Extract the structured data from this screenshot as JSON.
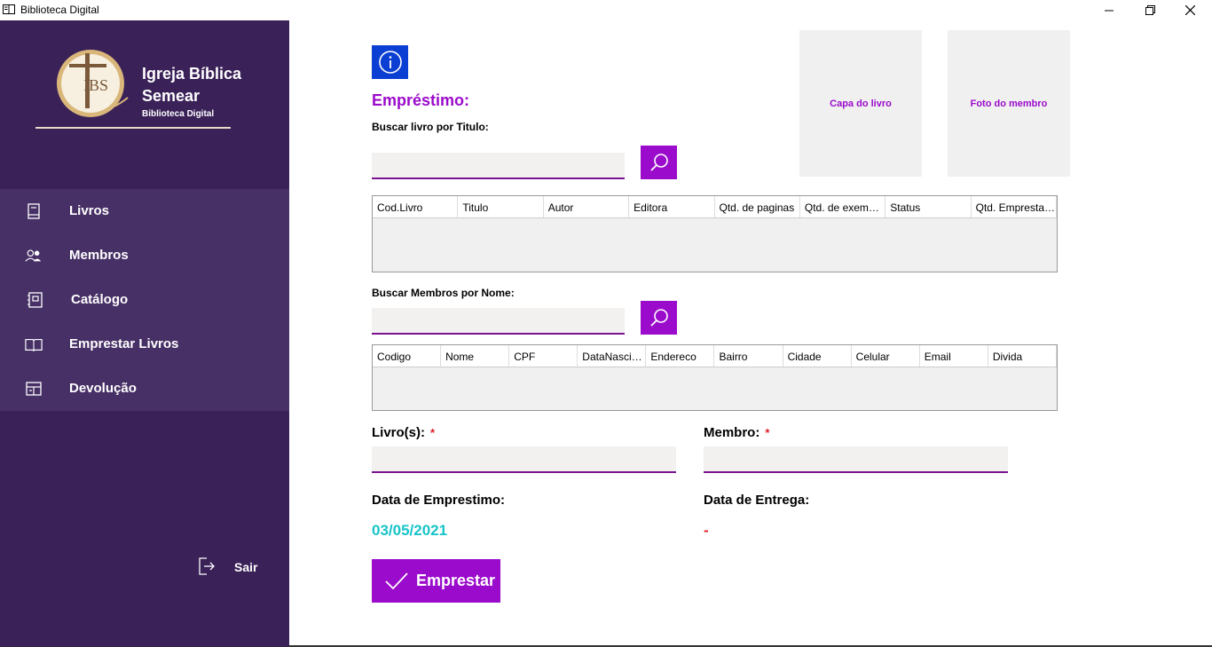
{
  "window": {
    "title": "Biblioteca Digital"
  },
  "sidebar": {
    "logo_text": "IBS",
    "church_name_line1": "Igreja Bíblica",
    "church_name_line2": "Semear",
    "subtitle": "Biblioteca Digital",
    "items": [
      {
        "label": "Livros",
        "icon": "book-icon"
      },
      {
        "label": "Membros",
        "icon": "members-icon"
      },
      {
        "label": "Catálogo",
        "icon": "catalog-icon"
      },
      {
        "label": "Emprestar Livros",
        "icon": "open-book-icon"
      },
      {
        "label": "Devolução",
        "icon": "return-icon"
      }
    ],
    "exit_label": "Sair"
  },
  "main": {
    "heading": "Empréstimo:",
    "search_book_label": "Buscar livro por Titulo:",
    "search_book_value": "",
    "book_cover_label": "Capa do livro",
    "member_photo_label": "Foto do membro",
    "books_table": {
      "columns": [
        "Cod.Livro",
        "Titulo",
        "Autor",
        "Editora",
        "Qtd. de paginas",
        "Qtd. de exemplares",
        "Status",
        "Qtd. Emprestados"
      ],
      "rows": []
    },
    "search_member_label": "Buscar Membros por Nome:",
    "search_member_value": "",
    "members_table": {
      "columns": [
        "Codigo",
        "Nome",
        "CPF",
        "DataNascimento",
        "Endereco",
        "Bairro",
        "Cidade",
        "Celular",
        "Email",
        "Divida"
      ],
      "rows": []
    },
    "books_field_label": "Livro(s):",
    "member_field_label": "Membro:",
    "required_mark": "*",
    "loan_date_label": "Data de Emprestimo:",
    "loan_date_value": "03/05/2021",
    "return_date_label": "Data de Entrega:",
    "return_date_value": "-",
    "lend_button_label": "Emprestar"
  },
  "colors": {
    "sidebar_bg": "#3a2158",
    "menu_bg": "#473066",
    "accent_purple": "#9b0bcb",
    "info_blue": "#0b3fd3",
    "date_cyan": "#18c4c9",
    "required_red": "#e0202a"
  }
}
